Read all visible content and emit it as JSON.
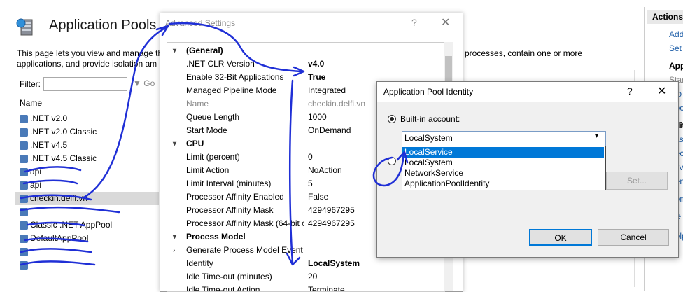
{
  "iis": {
    "title": "Application Pools",
    "description_left": "This page lets you view and manage the",
    "description_right": "er processes, contain one or more",
    "description_line2": "applications, and provide isolation am",
    "filter_label": "Filter:",
    "go_label": "Go",
    "column_name": "Name",
    "pools": [
      ".NET v2.0",
      ".NET v2.0 Classic",
      ".NET v4.5",
      ".NET v4.5 Classic",
      "api",
      "api",
      "checkin.delfi.vn",
      "",
      "Classic .NET AppPool",
      "DefaultAppPool",
      "",
      ""
    ],
    "selected_index": 6
  },
  "actions": {
    "title": "Actions",
    "items": [
      "Add",
      "Set",
      "App",
      "Star",
      "Sto",
      "Rec",
      "Edit",
      "Basi",
      "Rec",
      "Adv",
      "Ren",
      "Rem",
      "Vie",
      "Help"
    ]
  },
  "advanced": {
    "title": "Advanced Settings",
    "help": "?",
    "close": "✕",
    "rows": [
      {
        "type": "section",
        "name": "(General)",
        "caret": "▾"
      },
      {
        "name": ".NET CLR Version",
        "value": "v4.0",
        "bold": true
      },
      {
        "name": "Enable 32-Bit Applications",
        "value": "True",
        "bold": true
      },
      {
        "name": "Managed Pipeline Mode",
        "value": "Integrated"
      },
      {
        "name": "Name",
        "value": "checkin.delfi.vn",
        "gray": true
      },
      {
        "name": "Queue Length",
        "value": "1000"
      },
      {
        "name": "Start Mode",
        "value": "OnDemand"
      },
      {
        "type": "section",
        "name": "CPU",
        "caret": "▾"
      },
      {
        "name": "Limit (percent)",
        "value": "0"
      },
      {
        "name": "Limit Action",
        "value": "NoAction"
      },
      {
        "name": "Limit Interval (minutes)",
        "value": "5"
      },
      {
        "name": "Processor Affinity Enabled",
        "value": "False"
      },
      {
        "name": "Processor Affinity Mask",
        "value": "4294967295"
      },
      {
        "name": "Processor Affinity Mask (64-bit o",
        "value": "4294967295"
      },
      {
        "type": "section",
        "name": "Process Model",
        "caret": "▾"
      },
      {
        "name": "Generate Process Model Event L",
        "value": "",
        "caret": "›"
      },
      {
        "name": "Identity",
        "value": "LocalSystem",
        "bold": true
      },
      {
        "name": "Idle Time-out (minutes)",
        "value": "20"
      },
      {
        "name": "Idle Time-out Action",
        "value": "Terminate"
      }
    ]
  },
  "identity": {
    "title": "Application Pool Identity",
    "help": "?",
    "close": "✕",
    "builtin_label": "Built-in account:",
    "selected": "LocalSystem",
    "options": [
      "LocalService",
      "LocalSystem",
      "NetworkService",
      "ApplicationPoolIdentity"
    ],
    "highlighted_index": 0,
    "set_label": "Set...",
    "ok_label": "OK",
    "cancel_label": "Cancel"
  },
  "colors": {
    "accent": "#0078d7",
    "ink": "#1f2fd6"
  }
}
